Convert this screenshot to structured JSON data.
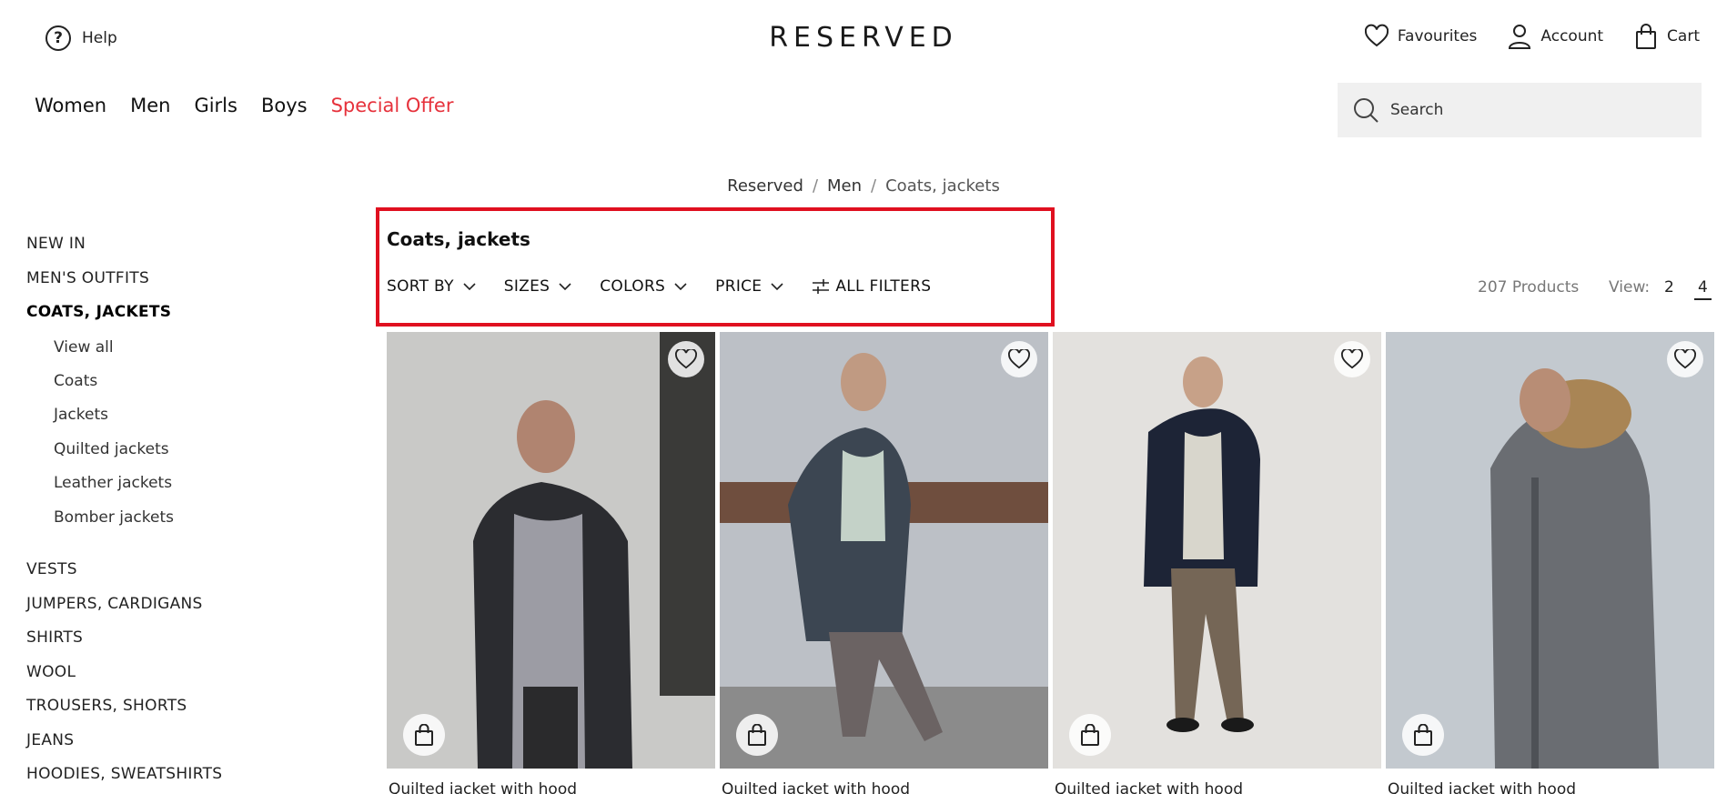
{
  "header": {
    "help_label": "Help",
    "help_icon": "?",
    "logo": "RESERVED",
    "favourites_label": "Favourites",
    "account_label": "Account",
    "cart_label": "Cart"
  },
  "nav": {
    "items": [
      "Women",
      "Men",
      "Girls",
      "Boys"
    ],
    "special": "Special Offer",
    "special_color": "#e6323c"
  },
  "search": {
    "placeholder": "Search"
  },
  "breadcrumb": {
    "items": [
      "Reserved",
      "Men",
      "Coats, jackets"
    ],
    "separator": "/"
  },
  "sidebar": {
    "categories_top": [
      "NEW IN",
      "MEN'S OUTFITS",
      "COATS, JACKETS"
    ],
    "subcategories": [
      "View all",
      "Coats",
      "Jackets",
      "Quilted jackets",
      "Leather jackets",
      "Bomber jackets"
    ],
    "categories_bottom": [
      "VESTS",
      "JUMPERS, CARDIGANS",
      "SHIRTS",
      "WOOL",
      "TROUSERS, SHORTS",
      "JEANS",
      "HOODIES, SWEATSHIRTS"
    ]
  },
  "listing": {
    "title": "Coats, jackets",
    "filters": [
      "SORT BY",
      "SIZES",
      "COLORS",
      "PRICE"
    ],
    "all_filters": "ALL FILTERS",
    "count": "207 Products",
    "view_label": "View:",
    "view_options": [
      "2",
      "4"
    ],
    "highlight_color": "#e01020"
  },
  "products": [
    {
      "name": "Quilted jacket with hood",
      "bg": "#c9c9c7",
      "jacket": "#2b2c30",
      "sweater": "#9c9ca4"
    },
    {
      "name": "Quilted jacket with hood",
      "bg": "#bcc0c6",
      "jacket": "#3c4652",
      "sweater": "#c4d2c8"
    },
    {
      "name": "Quilted jacket with hood",
      "bg": "#e3e1de",
      "jacket": "#1d2436",
      "sweater": "#d8d6cc"
    },
    {
      "name": "Quilted jacket with hood",
      "bg": "#c3c9cf",
      "jacket": "#6a6d72",
      "sweater": "#5b5f64"
    }
  ]
}
